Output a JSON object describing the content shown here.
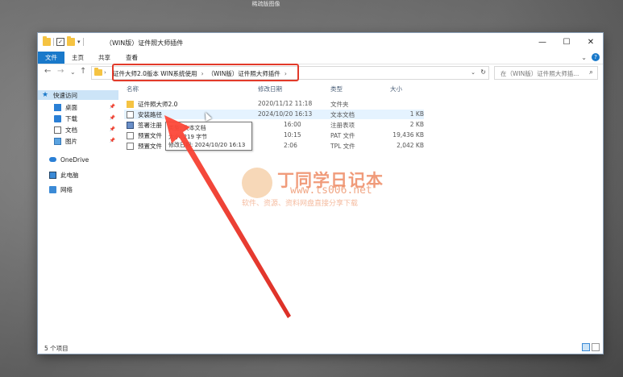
{
  "top_caption": "稀疏版图像",
  "window": {
    "title": "（WIN版）证件照大师插件",
    "controls": {
      "minimize": "—",
      "maximize": "☐",
      "close": "✕"
    }
  },
  "quick_access_toolbar": {
    "dropdown": "▾"
  },
  "ribbon": {
    "tabs": [
      "文件",
      "主页",
      "共享",
      "查看"
    ],
    "collapse": "⌄",
    "help": "?"
  },
  "address_bar": {
    "back": "←",
    "forward": "→",
    "dropdown": "⌄",
    "up": "↑",
    "crumbs": [
      "证件大师2.0版本 WIN系统使用",
      "（WIN版）证件照大师插件"
    ],
    "crumb_sep": "›",
    "refresh": "↻",
    "addr_dropdown": "⌄"
  },
  "search": {
    "placeholder": "在（WIN版）证件照大师插...",
    "icon": "⌕"
  },
  "sidebar": {
    "items": [
      {
        "label": "快速访问",
        "icon": "star-icon"
      },
      {
        "label": "桌面",
        "icon": "desktop-icon",
        "pin": "📌"
      },
      {
        "label": "下载",
        "icon": "download-icon",
        "pin": "📌"
      },
      {
        "label": "文档",
        "icon": "document-icon",
        "pin": "📌"
      },
      {
        "label": "图片",
        "icon": "picture-icon",
        "pin": "📌"
      },
      {
        "label": "OneDrive",
        "icon": "cloud-icon"
      },
      {
        "label": "此电脑",
        "icon": "computer-icon"
      },
      {
        "label": "网络",
        "icon": "network-icon"
      }
    ]
  },
  "columns": {
    "name": "名称",
    "date": "修改日期",
    "type": "类型",
    "size": "大小"
  },
  "files": [
    {
      "name": "证件照大师2.0",
      "date": "2020/11/12 11:18",
      "type": "文件夹",
      "size": "",
      "icon": "folder-icon"
    },
    {
      "name": "安装路径",
      "date": "2024/10/20 16:13",
      "type": "文本文档",
      "size": "1 KB",
      "icon": "text-file-icon"
    },
    {
      "name": "签署注册",
      "date": "16:00",
      "type": "注册表项",
      "size": "2 KB",
      "icon": "registry-file-icon"
    },
    {
      "name": "预置文件",
      "date": "10:15",
      "type": "PAT 文件",
      "size": "19,436 KB",
      "icon": "pat-file-icon"
    },
    {
      "name": "预置文件",
      "date": "2:06",
      "type": "TPL 文件",
      "size": "2,042 KB",
      "icon": "tpl-file-icon"
    }
  ],
  "tooltip": {
    "type_line": "类型: 文本文档",
    "size_line": "大小: 219 字节",
    "date_line": "修改日期: 2024/10/20 16:13"
  },
  "watermark": {
    "title": "丁同学日记本",
    "url": "www.ts006.net",
    "subtitle": "软件、资源、资料网盘直接分享下载"
  },
  "status": {
    "item_count": "5 个项目"
  },
  "colors": {
    "accent": "#1979ca",
    "annotation_red": "#e23a2a",
    "hover_row": "#e5f3ff"
  }
}
